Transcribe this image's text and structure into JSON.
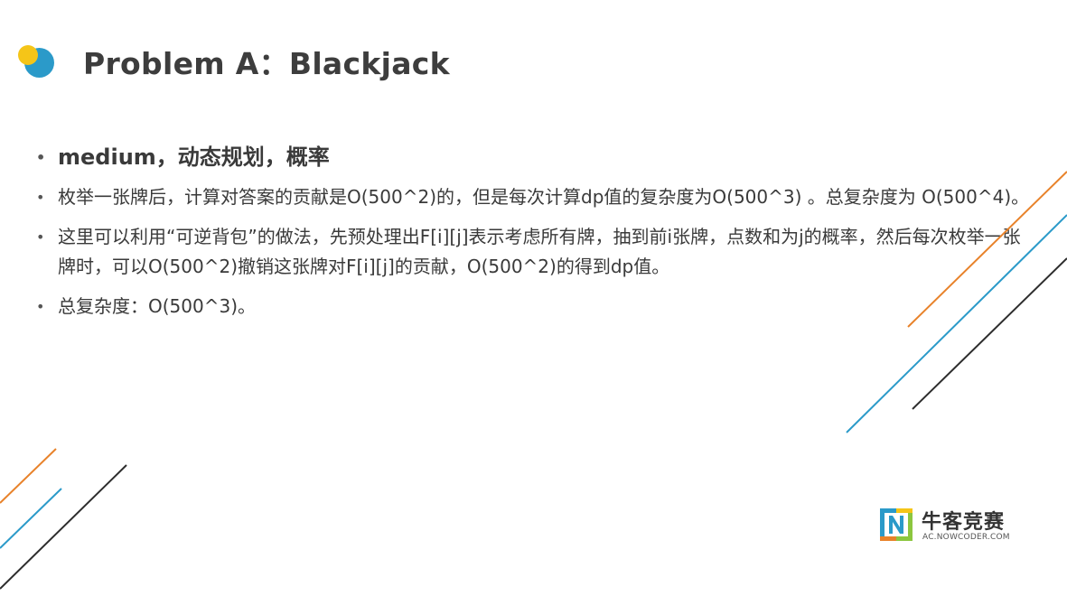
{
  "title": "Problem A：Blackjack",
  "bullets": [
    "medium，动态规划，概率",
    "枚举一张牌后，计算对答案的贡献是O(500^2)的，但是每次计算dp值的复杂度为O(500^3) 。总复杂度为 O(500^4)。",
    "这里可以利用“可逆背包”的做法，先预处理出F[i][j]表示考虑所有牌，抽到前i张牌，点数和为j的概率，然后每次枚举一张牌时，可以O(500^2)撤销这张牌对F[i][j]的贡献，O(500^2)的得到dp值。",
    "总复杂度：O(500^3)。"
  ],
  "logo": {
    "name": "牛客竞赛",
    "url": "AC.NOWCODER.COM"
  },
  "colors": {
    "orange": "#e8822a",
    "blue": "#2b9ac9",
    "dark": "#2d2d2d",
    "yellow": "#f5c518"
  }
}
